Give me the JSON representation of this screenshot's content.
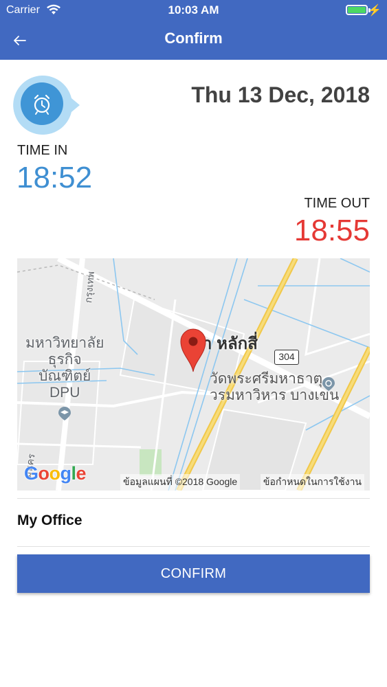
{
  "status_bar": {
    "carrier": "Carrier",
    "time": "10:03 AM",
    "battery_level": 1.0
  },
  "header": {
    "title": "Confirm",
    "back_icon": "arrow-left-icon"
  },
  "attendance": {
    "date": "Thu 13 Dec, 2018",
    "time_in_label": "TIME IN",
    "time_in": "18:52",
    "time_out_label": "TIME OUT",
    "time_out": "18:55",
    "alarm_icon": "alarm-clock-icon"
  },
  "map": {
    "labels": {
      "university": "มหาวิทยาลัย\nธุรกิจ\nบัณฑิตย์\nDPU",
      "area": "า หลักสี่",
      "temple": "วัดพระศรีมหาธาตุ\nวรมหาวิหาร บางเขน",
      "road_vertical": "กรุงเทพ",
      "road_lower": "มนคร"
    },
    "route_number": "304",
    "google_logo": "Google",
    "attribution": "ข้อมูลแผนที่ ©2018 Google",
    "terms": "ข้อกำหนดในการใช้งาน"
  },
  "location": {
    "name": "My Office"
  },
  "actions": {
    "confirm_label": "CONFIRM"
  },
  "colors": {
    "brand_blue": "#4169c1",
    "time_in": "#3f8fd2",
    "time_out": "#e53935",
    "battery": "#4cd964"
  }
}
